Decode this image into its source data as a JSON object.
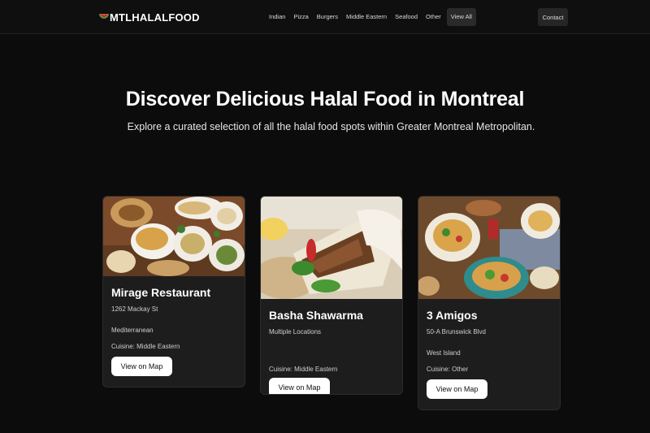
{
  "header": {
    "brand": "MTLHALALFOOD",
    "nav": [
      "Indian",
      "Pizza",
      "Burgers",
      "Middle Eastern",
      "Seafood",
      "Other"
    ],
    "view_all": "View All",
    "contact": "Contact"
  },
  "hero": {
    "title": "Discover Delicious Halal Food in Montreal",
    "subtitle": "Explore a curated selection of all the halal food spots within Greater Montreal Metropolitan."
  },
  "cards": [
    {
      "name": "Mirage Restaurant",
      "address": "1262 Mackay St",
      "area": "Mediterranean",
      "cuisine": "Cuisine: Middle Eastern",
      "button": "View on Map",
      "image": "platter-of-grilled-meats-and-dips"
    },
    {
      "name": "Basha Shawarma",
      "address": "Multiple Locations",
      "area": "",
      "cuisine": "Cuisine: Middle Eastern",
      "button": "View on Map",
      "image": "shawarma-wrap"
    },
    {
      "name": "3 Amigos",
      "address": "50-A Brunswick Blvd",
      "area": "West Island",
      "cuisine": "Cuisine: Other",
      "button": "View on Map",
      "image": "mexican-dishes-table"
    }
  ],
  "colors": {
    "background": "#0c0c0c",
    "card": "#1d1d1d",
    "button": "#ffffff"
  }
}
